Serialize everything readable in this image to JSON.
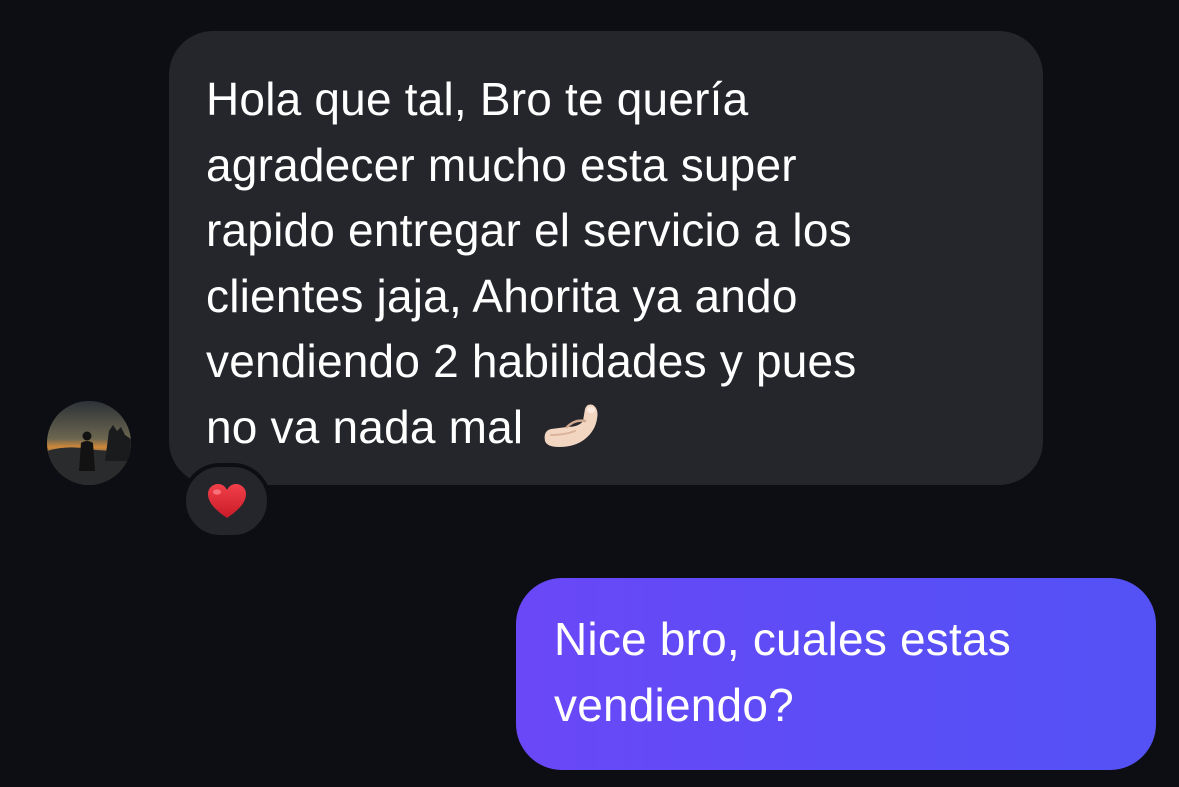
{
  "conversation": {
    "incoming": {
      "text": "Hola que tal, Bro te quería\nagradecer mucho esta super\nrapido entregar el servicio a los\nclientes jaja, Ahorita ya ando\nvendiendo 2 habilidades y pues\nno va nada mal",
      "inline_emoji": "pinching-hand",
      "reaction": "red-heart",
      "bubble_color": "#25262b"
    },
    "outgoing": {
      "text": "Nice bro, cuales estas\nvendiendo?",
      "bubble_color": "#5b4ef7"
    }
  },
  "colors": {
    "background": "#0d0e13",
    "text": "#ffffff",
    "heart": "#e02b35"
  }
}
